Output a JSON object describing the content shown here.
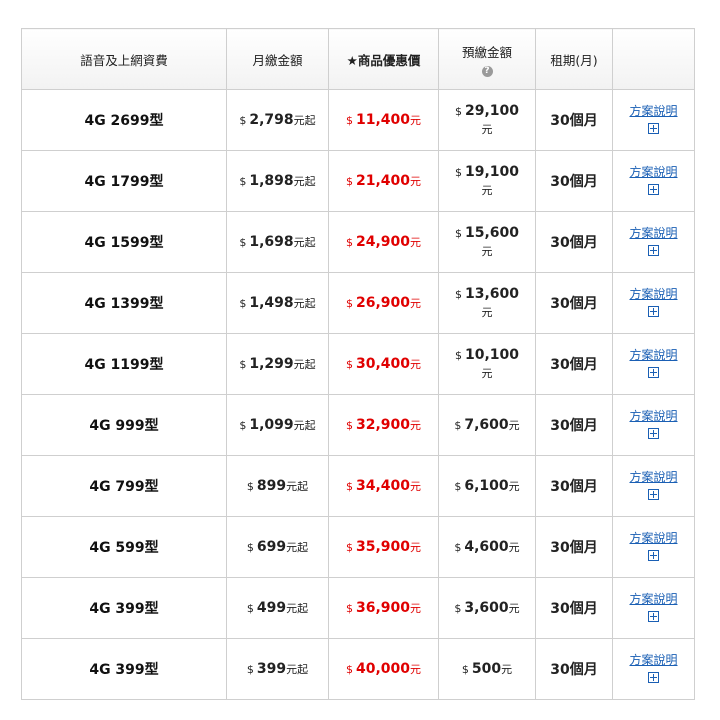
{
  "header": {
    "plan": "語音及上網資費",
    "monthly": "月繳金額",
    "promo_price": "★商品優惠價",
    "prepay": "預繳金額",
    "term": "租期(月)",
    "info": ""
  },
  "labels": {
    "currency": "$",
    "unit_yuan": "元",
    "unit_yuan_from": "元起",
    "link": "方案說明",
    "prepay_help": "?"
  },
  "rows": [
    {
      "plan": "4G 2699型",
      "monthly": "2,798",
      "promo": "11,400",
      "prepay": "29,100",
      "prepay_wrap": true,
      "term": "30個月"
    },
    {
      "plan": "4G 1799型",
      "monthly": "1,898",
      "promo": "21,400",
      "prepay": "19,100",
      "prepay_wrap": true,
      "term": "30個月"
    },
    {
      "plan": "4G 1599型",
      "monthly": "1,698",
      "promo": "24,900",
      "prepay": "15,600",
      "prepay_wrap": true,
      "term": "30個月"
    },
    {
      "plan": "4G 1399型",
      "monthly": "1,498",
      "promo": "26,900",
      "prepay": "13,600",
      "prepay_wrap": true,
      "term": "30個月"
    },
    {
      "plan": "4G 1199型",
      "monthly": "1,299",
      "promo": "30,400",
      "prepay": "10,100",
      "prepay_wrap": true,
      "term": "30個月"
    },
    {
      "plan": "4G 999型",
      "monthly": "1,099",
      "promo": "32,900",
      "prepay": "7,600",
      "prepay_wrap": false,
      "term": "30個月"
    },
    {
      "plan": "4G 799型",
      "monthly": "899",
      "promo": "34,400",
      "prepay": "6,100",
      "prepay_wrap": false,
      "term": "30個月"
    },
    {
      "plan": "4G 599型",
      "monthly": "699",
      "promo": "35,900",
      "prepay": "4,600",
      "prepay_wrap": false,
      "term": "30個月"
    },
    {
      "plan": "4G 399型",
      "monthly": "499",
      "promo": "36,900",
      "prepay": "3,600",
      "prepay_wrap": false,
      "term": "30個月"
    },
    {
      "plan": "4G 399型",
      "monthly": "399",
      "promo": "40,000",
      "prepay": "500",
      "prepay_wrap": false,
      "term": "30個月"
    }
  ],
  "colors": {
    "promo": "#e00000",
    "link": "#1a5fb4",
    "border": "#cfcfcf"
  }
}
